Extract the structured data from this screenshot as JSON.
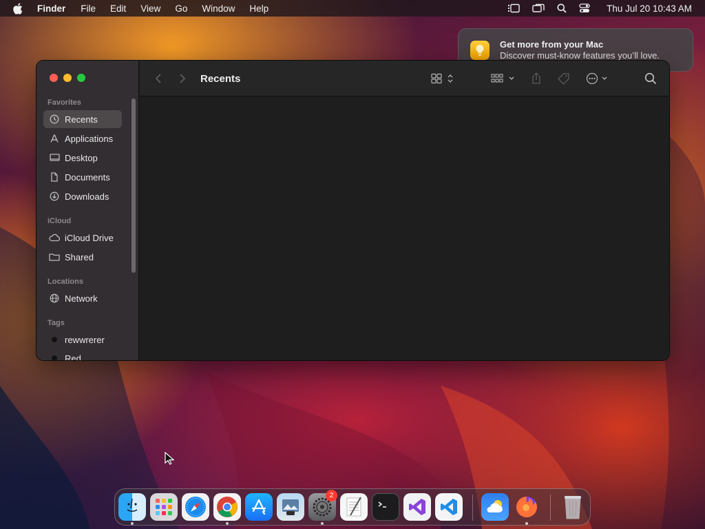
{
  "menubar": {
    "app_name": "Finder",
    "items": [
      "File",
      "Edit",
      "View",
      "Go",
      "Window",
      "Help"
    ],
    "clock": "Thu Jul 20  10:43 AM",
    "status_icons": [
      "stage-manager-icon",
      "screen-mirroring-icon",
      "spotlight-search-icon",
      "control-center-icon"
    ]
  },
  "notification": {
    "title": "Get more from your Mac",
    "body": "Discover must-know features you’ll love.",
    "icon": "lightbulb-icon"
  },
  "finder": {
    "title": "Recents",
    "sidebar": {
      "favorites_label": "Favorites",
      "favorites": [
        {
          "label": "Recents",
          "icon": "clock-icon",
          "selected": true
        },
        {
          "label": "Applications",
          "icon": "applications-icon"
        },
        {
          "label": "Desktop",
          "icon": "desktop-icon"
        },
        {
          "label": "Documents",
          "icon": "document-icon"
        },
        {
          "label": "Downloads",
          "icon": "download-icon"
        }
      ],
      "icloud_label": "iCloud",
      "icloud": [
        {
          "label": "iCloud Drive",
          "icon": "cloud-icon"
        },
        {
          "label": "Shared",
          "icon": "shared-folder-icon"
        }
      ],
      "locations_label": "Locations",
      "locations": [
        {
          "label": "Network",
          "icon": "globe-icon"
        }
      ],
      "tags_label": "Tags",
      "tags": [
        {
          "label": "rewwrerer",
          "color": "#111111"
        },
        {
          "label": "Red",
          "color": "#111111"
        }
      ]
    }
  },
  "dock": {
    "apps": [
      "Finder",
      "Launchpad",
      "Safari",
      "Google Chrome",
      "App Store",
      "Preview",
      "System Settings",
      "TextEdit",
      "Terminal",
      "Visual Studio",
      "Visual Studio Code",
      "Weather",
      "Firefox",
      "Trash"
    ],
    "settings_badge": "2"
  },
  "colors": {
    "close": "#ff5f57",
    "minimize": "#febc2e",
    "zoom": "#28c840",
    "badge": "#ff3b30"
  }
}
